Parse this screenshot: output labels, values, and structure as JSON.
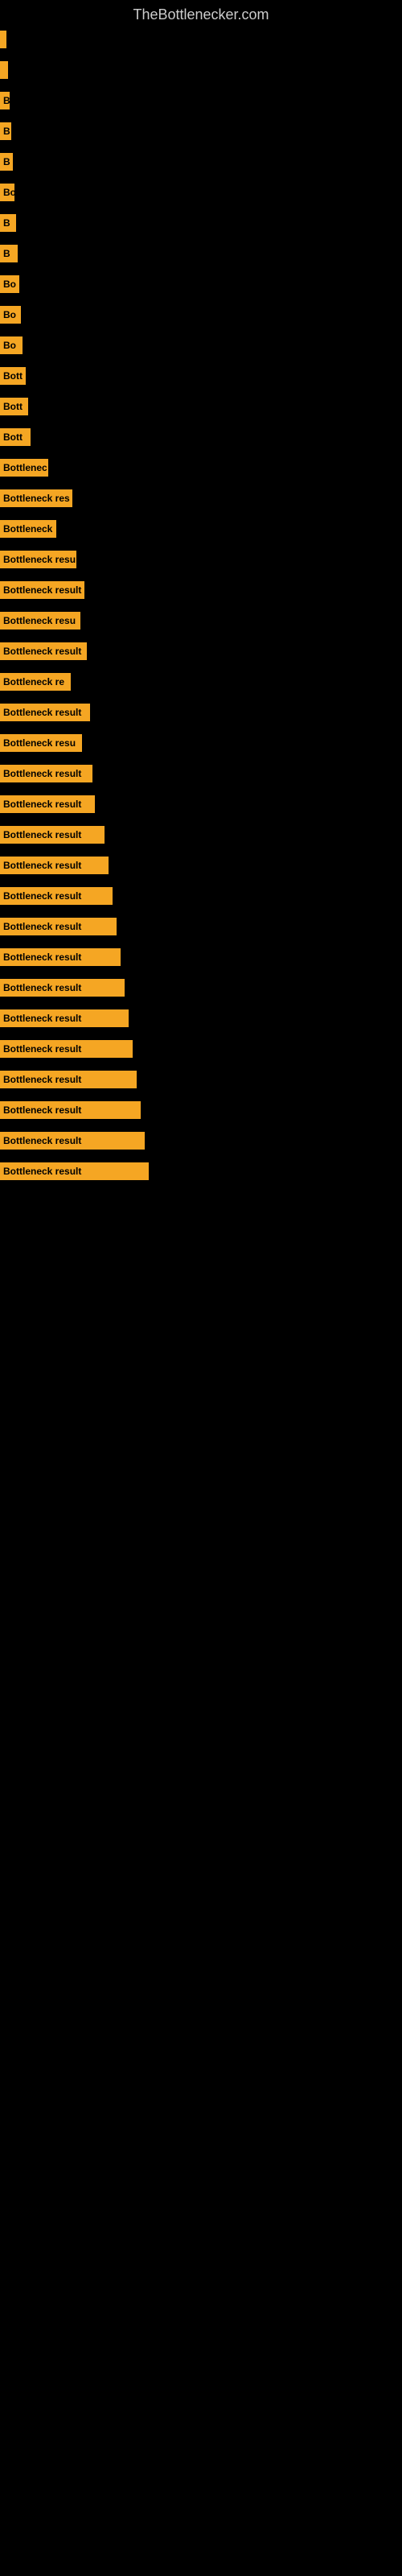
{
  "site": {
    "title": "TheBottlenecker.com"
  },
  "bars": [
    {
      "label": "",
      "width": 8,
      "text": ""
    },
    {
      "label": "",
      "width": 10,
      "text": ""
    },
    {
      "label": "B",
      "width": 12,
      "text": "B"
    },
    {
      "label": "B",
      "width": 14,
      "text": "B"
    },
    {
      "label": "B",
      "width": 16,
      "text": "B"
    },
    {
      "label": "Bo",
      "width": 18,
      "text": "Bo"
    },
    {
      "label": "B",
      "width": 20,
      "text": "B"
    },
    {
      "label": "B",
      "width": 22,
      "text": "B"
    },
    {
      "label": "Bo",
      "width": 24,
      "text": "Bo"
    },
    {
      "label": "Bo",
      "width": 26,
      "text": "Bo"
    },
    {
      "label": "Bo",
      "width": 28,
      "text": "Bo"
    },
    {
      "label": "Bott",
      "width": 32,
      "text": "Bott"
    },
    {
      "label": "Bott",
      "width": 35,
      "text": "Bott"
    },
    {
      "label": "Bott",
      "width": 38,
      "text": "Bott"
    },
    {
      "label": "Bottlenec",
      "width": 60,
      "text": "Bottlenec"
    },
    {
      "label": "Bottleneck res",
      "width": 90,
      "text": "Bottleneck res"
    },
    {
      "label": "Bottleneck",
      "width": 70,
      "text": "Bottleneck"
    },
    {
      "label": "Bottleneck resu",
      "width": 95,
      "text": "Bottleneck resu"
    },
    {
      "label": "Bottleneck result",
      "width": 105,
      "text": "Bottleneck result"
    },
    {
      "label": "Bottleneck resu",
      "width": 100,
      "text": "Bottleneck resu"
    },
    {
      "label": "Bottleneck result",
      "width": 108,
      "text": "Bottleneck result"
    },
    {
      "label": "Bottleneck re",
      "width": 88,
      "text": "Bottleneck re"
    },
    {
      "label": "Bottleneck result",
      "width": 112,
      "text": "Bottleneck result"
    },
    {
      "label": "Bottleneck resu",
      "width": 102,
      "text": "Bottleneck resu"
    },
    {
      "label": "Bottleneck result",
      "width": 115,
      "text": "Bottleneck result"
    },
    {
      "label": "Bottleneck result",
      "width": 118,
      "text": "Bottleneck result"
    },
    {
      "label": "Bottleneck result",
      "width": 130,
      "text": "Bottleneck result"
    },
    {
      "label": "Bottleneck result",
      "width": 135,
      "text": "Bottleneck result"
    },
    {
      "label": "Bottleneck result",
      "width": 140,
      "text": "Bottleneck result"
    },
    {
      "label": "Bottleneck result",
      "width": 145,
      "text": "Bottleneck result"
    },
    {
      "label": "Bottleneck result",
      "width": 150,
      "text": "Bottleneck result"
    },
    {
      "label": "Bottleneck result",
      "width": 155,
      "text": "Bottleneck result"
    },
    {
      "label": "Bottleneck result",
      "width": 160,
      "text": "Bottleneck result"
    },
    {
      "label": "Bottleneck result",
      "width": 165,
      "text": "Bottleneck result"
    },
    {
      "label": "Bottleneck result",
      "width": 170,
      "text": "Bottleneck result"
    },
    {
      "label": "Bottleneck result",
      "width": 175,
      "text": "Bottleneck result"
    },
    {
      "label": "Bottleneck result",
      "width": 180,
      "text": "Bottleneck result"
    },
    {
      "label": "Bottleneck result",
      "width": 185,
      "text": "Bottleneck result"
    }
  ]
}
